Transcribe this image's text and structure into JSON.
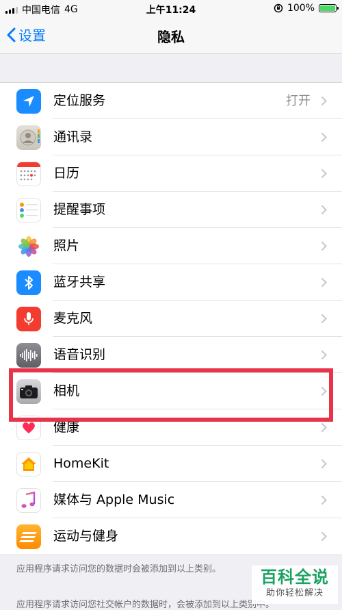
{
  "status_bar": {
    "carrier": "中国电信",
    "network": "4G",
    "time": "上午11:24",
    "battery": "100%",
    "battery_level": 1.0
  },
  "nav": {
    "back_label": "设置",
    "title": "隐私"
  },
  "rows": [
    {
      "label": "定位服务",
      "value": "打开",
      "icon": "location-arrow-icon"
    },
    {
      "label": "通讯录",
      "icon": "contacts-icon"
    },
    {
      "label": "日历",
      "icon": "calendar-icon"
    },
    {
      "label": "提醒事项",
      "icon": "reminders-icon"
    },
    {
      "label": "照片",
      "icon": "photos-icon"
    },
    {
      "label": "蓝牙共享",
      "icon": "bluetooth-icon"
    },
    {
      "label": "麦克风",
      "icon": "microphone-icon"
    },
    {
      "label": "语音识别",
      "icon": "speech-recognition-icon"
    },
    {
      "label": "相机",
      "icon": "camera-icon"
    },
    {
      "label": "健康",
      "icon": "health-icon"
    },
    {
      "label": "HomeKit",
      "icon": "homekit-icon"
    },
    {
      "label": "媒体与 Apple Music",
      "icon": "music-icon"
    },
    {
      "label": "运动与健身",
      "icon": "motion-fitness-icon"
    }
  ],
  "footer": {
    "note1": "应用程序请求访问您的数据时会被添加到以上类别。",
    "note2": "应用程序请求访问您社交帐户的数据时，会被添加到以上类别中。"
  },
  "watermark": {
    "title": "百科全说",
    "subtitle": "助你轻松解决"
  },
  "colors": {
    "accent": "#007aff",
    "highlight": "#e8344a",
    "watermark": "#1aa260"
  }
}
